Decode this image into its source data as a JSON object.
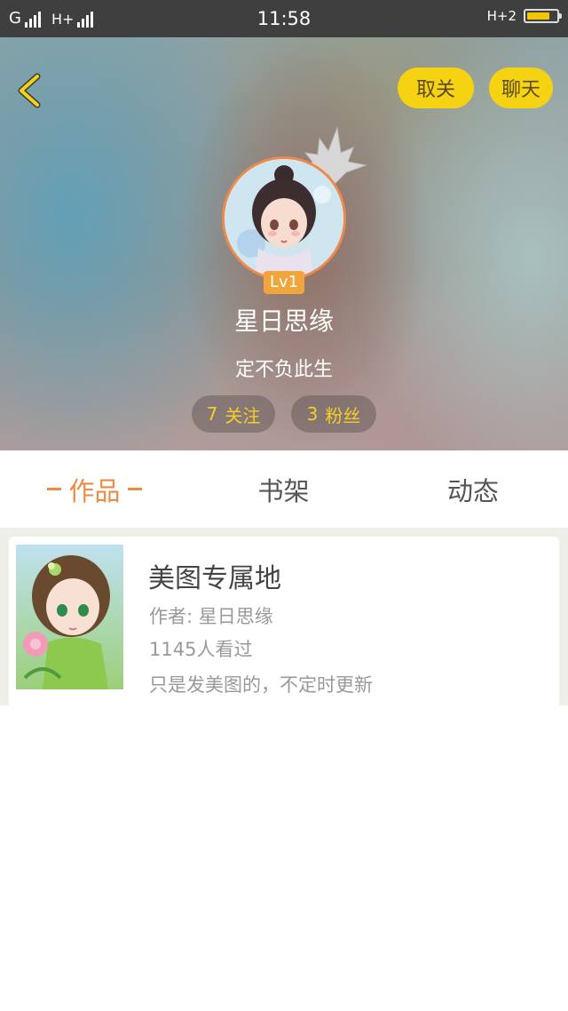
{
  "status_bar": {
    "carrier": "G",
    "network": "H+",
    "time": "11:58",
    "network_right": "H+2",
    "battery_level": 0.8
  },
  "header": {
    "unfollow_label": "取关",
    "chat_label": "聊天",
    "level": "Lv1",
    "username": "星日思缘",
    "signature": "定不负此生",
    "following_count": "7",
    "following_label": "关注",
    "fans_count": "3",
    "fans_label": "粉丝",
    "accent_color": "#f5d312"
  },
  "tabs": {
    "works": "作品",
    "shelf": "书架",
    "activity": "动态",
    "active_color": "#ef8a45"
  },
  "books": [
    {
      "title": "美图专属地",
      "author": "作者: 星日思缘",
      "views": "1145人看过",
      "description": "只是发美图的，不定时更新"
    }
  ]
}
